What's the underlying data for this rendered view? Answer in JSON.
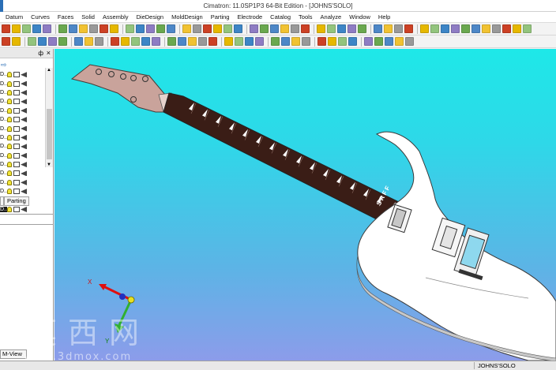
{
  "window": {
    "title": "Cimatron: 11.0SP1P3 64-Bit Edition - [JOHNS'SOLO]"
  },
  "menu": [
    "Curves",
    "Faces",
    "Solid",
    "Assembly",
    "DieDesign",
    "MoldDesign",
    "Parting",
    "Electrode",
    "Catalog",
    "Tools",
    "Analyze",
    "Window",
    "Help"
  ],
  "menu_first": "Datum",
  "panel": {
    "pin_label": "ф",
    "close_label": "×",
    "row_label": "D...",
    "row_count": 16,
    "tabs": [
      "Parting"
    ]
  },
  "viewport": {
    "axis_x_label": "X",
    "axis_y_label": "Y",
    "fret_text": "SRFF"
  },
  "view_tab": "M-View",
  "status": {
    "right": "JOHNS'SOLO"
  },
  "watermark": {
    "chars": "莫西网",
    "url": "www.3dmox.com"
  },
  "colors": {
    "viewport_top": "#1ee8e8",
    "viewport_bottom": "#8c9cea",
    "headstock": "#c9a39b",
    "fretboard": "#3a1d16",
    "body": "#ffffff"
  }
}
